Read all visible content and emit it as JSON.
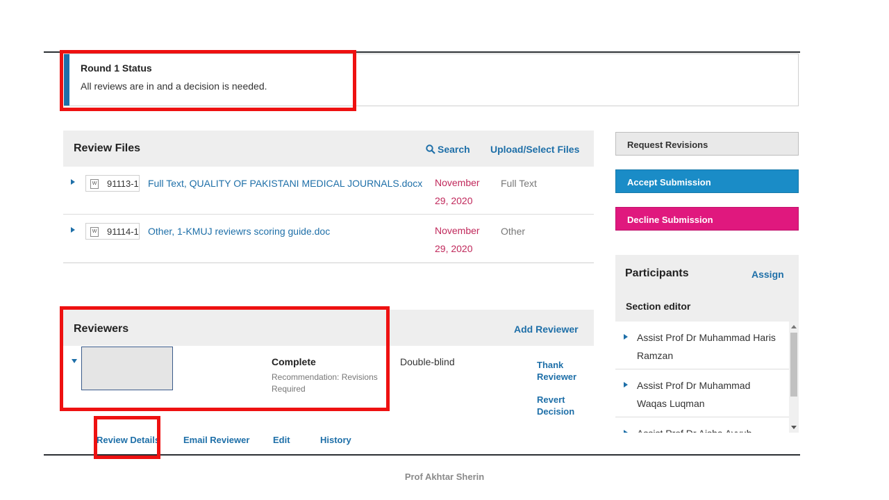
{
  "status": {
    "title": "Round 1 Status",
    "text": "All reviews are in and a decision is needed."
  },
  "review_files": {
    "title": "Review Files",
    "search_label": "Search",
    "upload_label": "Upload/Select Files",
    "rows": [
      {
        "id": "91113-1",
        "name": "Full Text, QUALITY OF PAKISTANI MEDICAL JOURNALS.docx",
        "date_line1": "November",
        "date_line2": "29, 2020",
        "type": "Full Text"
      },
      {
        "id": "91114-1",
        "name": "Other, 1-KMUJ reviewrs scoring guide.doc",
        "date_line1": "November",
        "date_line2": "29, 2020",
        "type": "Other"
      }
    ]
  },
  "actions": {
    "request_revisions": "Request Revisions",
    "accept_submission": "Accept Submission",
    "decline_submission": "Decline Submission"
  },
  "participants": {
    "title": "Participants",
    "assign_label": "Assign",
    "section_label": "Section editor",
    "items": [
      "Assist Prof Dr Muhammad Haris Ramzan",
      "Assist Prof Dr Muhammad Waqas Luqman",
      "Assist Prof Dr Aisha Ayyub"
    ]
  },
  "reviewers": {
    "title": "Reviewers",
    "add_label": "Add Reviewer",
    "row": {
      "status": "Complete",
      "recommendation": "Recommendation: Revisions Required",
      "method": "Double-blind",
      "thank_label": "Thank Reviewer",
      "revert_label": "Revert Decision"
    },
    "links": {
      "review_details": "Review Details",
      "email_reviewer": "Email Reviewer",
      "edit": "Edit",
      "history": "History"
    }
  },
  "footer": "Prof Akhtar Sherin",
  "colors": {
    "primary": "#1e6fa8",
    "accept": "#1a8cc7",
    "decline": "#e0187e",
    "date": "#c0285b",
    "highlight": "#ee1111"
  }
}
